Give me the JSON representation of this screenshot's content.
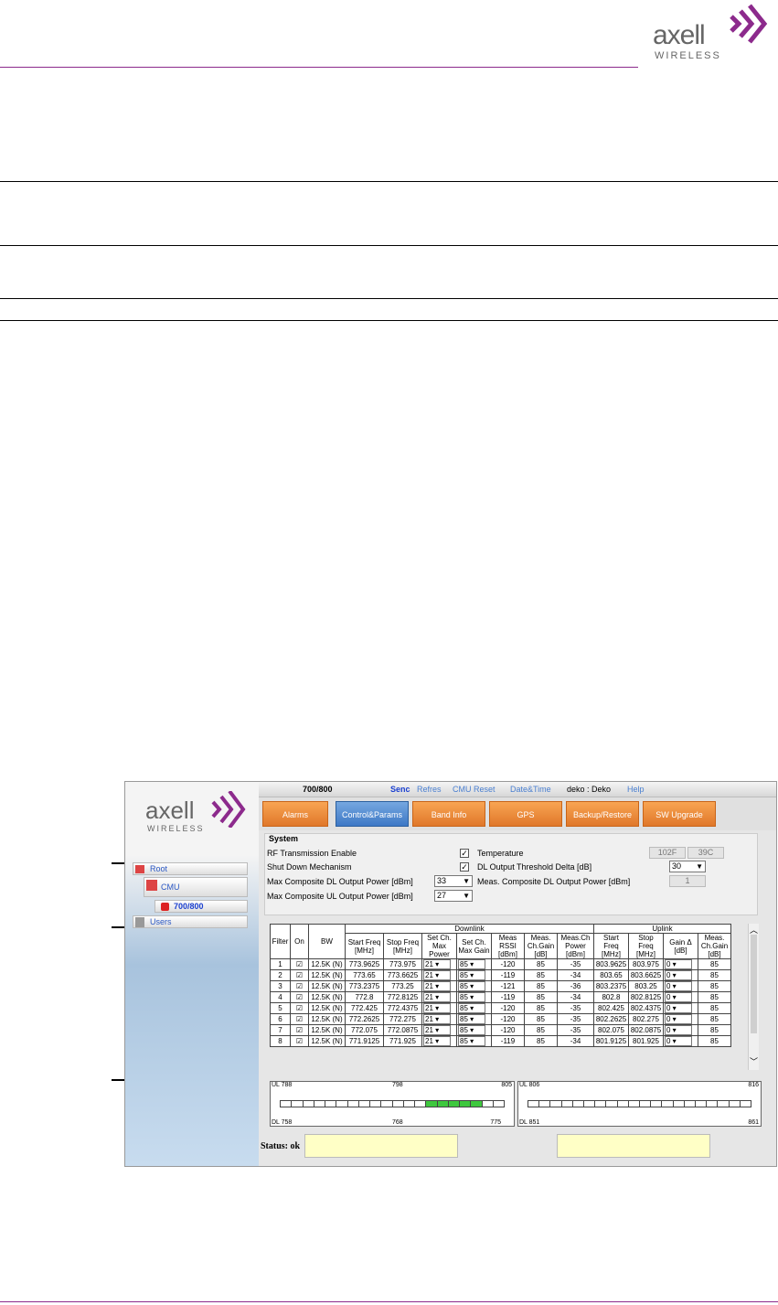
{
  "brand": {
    "name": "axell",
    "sub": "WIRELESS",
    "color": "#8c2a8c"
  },
  "app": {
    "menu": {
      "device": "700/800",
      "send": "Senc",
      "refresh": "Refres",
      "cmu_reset": "CMU Reset",
      "datetime": "Date&Time",
      "user": "deko : Deko",
      "help": "Help"
    },
    "tabs": [
      "Alarms",
      "Control&Params",
      "Band Info",
      "GPS",
      "Backup/Restore",
      "SW Upgrade"
    ],
    "active_tab": "Control&Params",
    "sidebar": {
      "brand": "axell",
      "brand_sub": "WIRELESS",
      "root": "Root",
      "cmu": "CMU",
      "device": "700/800",
      "users": "Users"
    },
    "system": {
      "title": "System",
      "rf_enable": "RF Transmission Enable",
      "shutdown": "Shut Down Mechanism",
      "max_dl": "Max Composite DL Output Power [dBm]",
      "max_dl_val": "33",
      "max_ul": "Max Composite UL Output Power [dBm]",
      "max_ul_val": "27",
      "temperature": "Temperature",
      "temp_f": "102F",
      "temp_c": "39C",
      "dl_threshold": "DL Output Threshold Delta [dB]",
      "dl_threshold_val": "30",
      "meas_dl": "Meas. Composite DL Output Power [dBm]",
      "meas_dl_val": "1"
    },
    "table": {
      "group_downlink": "Downlink",
      "group_uplink": "Uplink",
      "headers": [
        "Filter",
        "On",
        "BW",
        "Start Freq [MHz]",
        "Stop Freq [MHz]",
        "Set Ch. Max Power",
        "Set Ch. Max Gain",
        "Meas RSSI [dBm]",
        "Meas. Ch.Gain [dB]",
        "Meas.Ch Power [dBm]",
        "Start Freq [MHz]",
        "Stop Freq [MHz]",
        "Gain Δ [dB]",
        "Meas. Ch.Gain [dB]"
      ],
      "rows": [
        [
          "1",
          "12.5K (N)",
          "773.9625",
          "773.975",
          "21",
          "85",
          "-120",
          "85",
          "-35",
          "803.9625",
          "803.975",
          "0",
          "85"
        ],
        [
          "2",
          "12.5K (N)",
          "773.65",
          "773.6625",
          "21",
          "85",
          "-119",
          "85",
          "-34",
          "803.65",
          "803.6625",
          "0",
          "85"
        ],
        [
          "3",
          "12.5K (N)",
          "773.2375",
          "773.25",
          "21",
          "85",
          "-121",
          "85",
          "-36",
          "803.2375",
          "803.25",
          "0",
          "85"
        ],
        [
          "4",
          "12.5K (N)",
          "772.8",
          "772.8125",
          "21",
          "85",
          "-119",
          "85",
          "-34",
          "802.8",
          "802.8125",
          "0",
          "85"
        ],
        [
          "5",
          "12.5K (N)",
          "772.425",
          "772.4375",
          "21",
          "85",
          "-120",
          "85",
          "-35",
          "802.425",
          "802.4375",
          "0",
          "85"
        ],
        [
          "6",
          "12.5K (N)",
          "772.2625",
          "772.275",
          "21",
          "85",
          "-120",
          "85",
          "-35",
          "802.2625",
          "802.275",
          "0",
          "85"
        ],
        [
          "7",
          "12.5K (N)",
          "772.075",
          "772.0875",
          "21",
          "85",
          "-120",
          "85",
          "-35",
          "802.075",
          "802.0875",
          "0",
          "85"
        ],
        [
          "8",
          "12.5K (N)",
          "771.9125",
          "771.925",
          "21",
          "85",
          "-119",
          "85",
          "-34",
          "801.9125",
          "801.925",
          "0",
          "85"
        ]
      ]
    },
    "band_left": {
      "ul_start": "UL 788",
      "ul_mid": "798",
      "ul_end": "805",
      "dl_start": "DL 758",
      "dl_mid": "768",
      "dl_end": "775"
    },
    "band_right": {
      "ul_start": "UL 806",
      "ul_end": "816",
      "dl_start": "DL 851",
      "dl_end": "861"
    },
    "status": "Status: ok"
  }
}
